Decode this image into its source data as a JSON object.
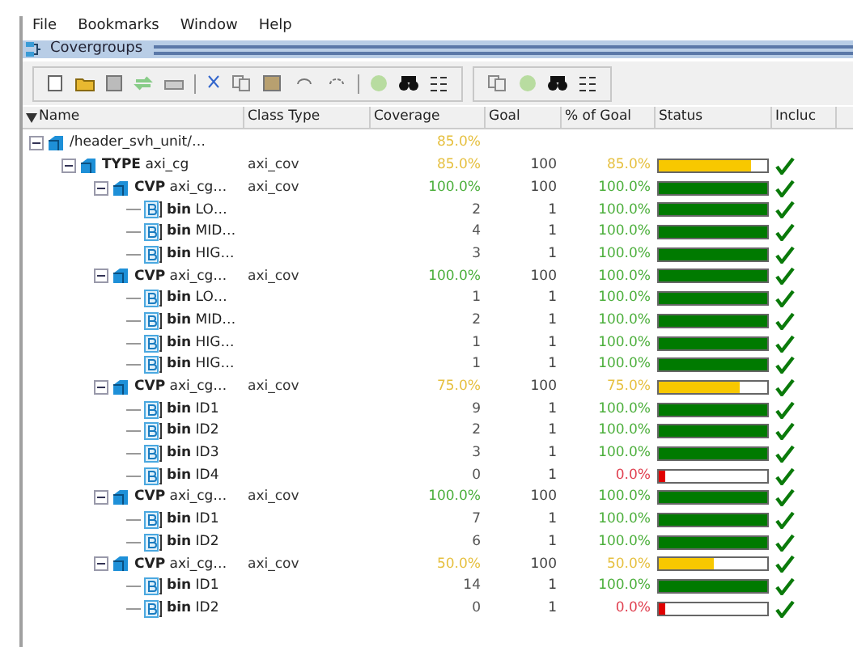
{
  "menu": [
    "File",
    "Bookmarks",
    "Window",
    "Help"
  ],
  "panel": {
    "title": "Covergroups"
  },
  "columns": [
    "Name",
    "Class Type",
    "Coverage",
    "Goal",
    "% of Goal",
    "Status",
    "Incluc"
  ],
  "tree": [
    {
      "kind": "root",
      "name": "/header_svh_unit/…",
      "coverage": "85.0%",
      "color": "#e6c040",
      "expanded": true,
      "children": [
        {
          "kind": "type",
          "name": "**TYPE** axi_cg",
          "class_type": "axi_cov",
          "coverage": "85.0%",
          "goal": "100",
          "pct": "85.0%",
          "level": 0.85,
          "included": true,
          "expanded": true,
          "children": [
            {
              "kind": "cvp",
              "name": "**CVP** axi_cg…",
              "class_type": "axi_cov",
              "coverage": "100.0%",
              "goal": "100",
              "pct": "100.0%",
              "level": 1,
              "included": true,
              "expanded": true,
              "children": [
                {
                  "kind": "bin",
                  "name": "**bin** LO…",
                  "coverage": "2",
                  "goal": "1",
                  "pct": "100.0%",
                  "level": 1,
                  "included": true
                },
                {
                  "kind": "bin",
                  "name": "**bin** MID…",
                  "coverage": "4",
                  "goal": "1",
                  "pct": "100.0%",
                  "level": 1,
                  "included": true
                },
                {
                  "kind": "bin",
                  "name": "**bin** HIG…",
                  "coverage": "3",
                  "goal": "1",
                  "pct": "100.0%",
                  "level": 1,
                  "included": true
                }
              ]
            },
            {
              "kind": "cvp",
              "name": "**CVP** axi_cg…",
              "class_type": "axi_cov",
              "coverage": "100.0%",
              "goal": "100",
              "pct": "100.0%",
              "level": 1,
              "included": true,
              "expanded": true,
              "children": [
                {
                  "kind": "bin",
                  "name": "**bin** LO…",
                  "coverage": "1",
                  "goal": "1",
                  "pct": "100.0%",
                  "level": 1,
                  "included": true
                },
                {
                  "kind": "bin",
                  "name": "**bin** MID…",
                  "coverage": "2",
                  "goal": "1",
                  "pct": "100.0%",
                  "level": 1,
                  "included": true
                },
                {
                  "kind": "bin",
                  "name": "**bin** HIG…",
                  "coverage": "1",
                  "goal": "1",
                  "pct": "100.0%",
                  "level": 1,
                  "included": true
                },
                {
                  "kind": "bin",
                  "name": "**bin** HIG…",
                  "coverage": "1",
                  "goal": "1",
                  "pct": "100.0%",
                  "level": 1,
                  "included": true
                }
              ]
            },
            {
              "kind": "cvp",
              "name": "**CVP** axi_cg…",
              "class_type": "axi_cov",
              "coverage": "75.0%",
              "goal": "100",
              "pct": "75.0%",
              "level": 0.75,
              "included": true,
              "expanded": true,
              "children": [
                {
                  "kind": "bin",
                  "name": "**bin** ID1",
                  "coverage": "9",
                  "goal": "1",
                  "pct": "100.0%",
                  "level": 1,
                  "included": true
                },
                {
                  "kind": "bin",
                  "name": "**bin** ID2",
                  "coverage": "2",
                  "goal": "1",
                  "pct": "100.0%",
                  "level": 1,
                  "included": true
                },
                {
                  "kind": "bin",
                  "name": "**bin** ID3",
                  "coverage": "3",
                  "goal": "1",
                  "pct": "100.0%",
                  "level": 1,
                  "included": true
                },
                {
                  "kind": "bin",
                  "name": "**bin** ID4",
                  "coverage": "0",
                  "goal": "1",
                  "pct": "0.0%",
                  "level": 0,
                  "included": true
                }
              ]
            },
            {
              "kind": "cvp",
              "name": "**CVP** axi_cg…",
              "class_type": "axi_cov",
              "coverage": "100.0%",
              "goal": "100",
              "pct": "100.0%",
              "level": 1,
              "included": true,
              "expanded": true,
              "children": [
                {
                  "kind": "bin",
                  "name": "**bin** ID1",
                  "coverage": "7",
                  "goal": "1",
                  "pct": "100.0%",
                  "level": 1,
                  "included": true
                },
                {
                  "kind": "bin",
                  "name": "**bin** ID2",
                  "coverage": "6",
                  "goal": "1",
                  "pct": "100.0%",
                  "level": 1,
                  "included": true
                }
              ]
            },
            {
              "kind": "cvp",
              "name": "**CVP** axi_cg…",
              "class_type": "axi_cov",
              "coverage": "50.0%",
              "goal": "100",
              "pct": "50.0%",
              "level": 0.5,
              "included": true,
              "expanded": true,
              "children": [
                {
                  "kind": "bin",
                  "name": "**bin** ID1",
                  "coverage": "14",
                  "goal": "1",
                  "pct": "100.0%",
                  "level": 1,
                  "included": true
                },
                {
                  "kind": "bin",
                  "name": "**bin** ID2",
                  "coverage": "0",
                  "goal": "1",
                  "pct": "0.0%",
                  "level": 0,
                  "included": true
                }
              ]
            }
          ]
        }
      ]
    }
  ]
}
